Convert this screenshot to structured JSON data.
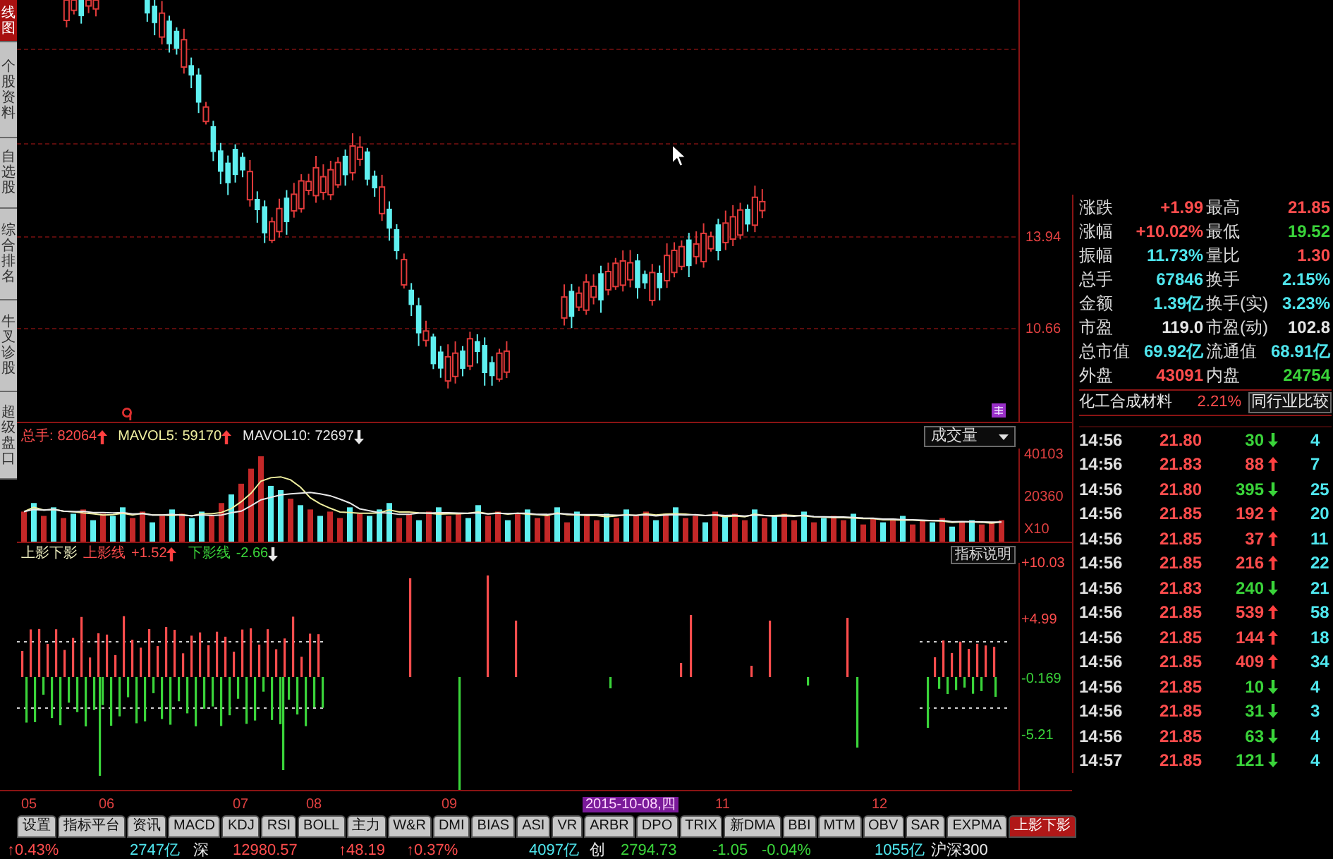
{
  "sidebar": {
    "tabs": [
      {
        "label": "线图",
        "selected": true
      },
      {
        "label": "个股资料",
        "selected": false
      },
      {
        "label": "自选股",
        "selected": false
      },
      {
        "label": "综合排名",
        "selected": false
      },
      {
        "label": "牛叉诊股",
        "selected": false
      },
      {
        "label": "超级盘口",
        "selected": false
      }
    ]
  },
  "price_panel": {
    "axis_labels": [
      "13.94",
      "10.66"
    ]
  },
  "volume_panel": {
    "legend": [
      {
        "label": "总手:",
        "value": "82064",
        "rising": true,
        "color": "#ff4d4d"
      },
      {
        "label": "MAVOL5:",
        "value": "59170",
        "rising": true,
        "color": "#f0f0a0"
      },
      {
        "label": "MAVOL10:",
        "value": "72697",
        "rising": false,
        "color": "#e8e8e8"
      }
    ],
    "indicator_select": {
      "value": "成交量"
    },
    "unit_label": "X10",
    "chart_data": {
      "type": "bar",
      "ylim": [
        0,
        43400
      ],
      "yticks": [
        20360,
        40103
      ],
      "stacked": true,
      "series": [
        {
          "color": "#c42828",
          "values": [
            14000,
            null,
            12000,
            null,
            11000,
            null,
            15000,
            null,
            13000,
            null,
            null,
            11000,
            14000,
            null,
            12000,
            null,
            13000,
            null,
            null,
            12000,
            18000,
            null,
            27000,
            34000,
            39800,
            null,
            null,
            20000,
            null,
            15000,
            null,
            14000,
            11000,
            null,
            13000,
            null,
            null,
            null,
            11000,
            13000,
            null,
            14000,
            null,
            12000,
            13000,
            null,
            null,
            12000,
            14000,
            null,
            13000,
            null,
            11000,
            12000,
            null,
            9000,
            null,
            12000,
            10000,
            null,
            11000,
            null,
            12000,
            14000,
            null,
            13000,
            null,
            11000,
            12000,
            null,
            14000,
            null,
            13000,
            10000,
            null,
            11000,
            null,
            13000,
            10000,
            null,
            9000,
            null,
            12000,
            10000,
            null,
            8000,
            11000,
            null,
            10000,
            null,
            8000,
            10000,
            null,
            11000,
            null,
            9000,
            null,
            8000,
            9000,
            10000
          ]
        },
        {
          "color": "#5ff0f0",
          "values": [
            null,
            18000,
            null,
            16000,
            null,
            13000,
            null,
            10000,
            null,
            12000,
            16000,
            null,
            null,
            9000,
            null,
            15000,
            null,
            11000,
            14000,
            null,
            null,
            22000,
            null,
            null,
            null,
            26000,
            24000,
            null,
            17000,
            null,
            12000,
            null,
            null,
            16000,
            null,
            12000,
            15000,
            18000,
            null,
            null,
            10000,
            null,
            16000,
            null,
            null,
            11000,
            17000,
            null,
            null,
            10000,
            null,
            15000,
            null,
            null,
            16000,
            null,
            14000,
            null,
            null,
            13000,
            null,
            15000,
            null,
            null,
            10000,
            null,
            16000,
            null,
            null,
            9000,
            null,
            12000,
            null,
            null,
            15000,
            null,
            12000,
            null,
            null,
            14000,
            null,
            11000,
            null,
            null,
            13000,
            null,
            null,
            9000,
            null,
            12000,
            null,
            null,
            9000,
            null,
            7000,
            null,
            10000,
            null,
            null,
            null
          ]
        },
        {
          "type": "line",
          "color": "#f0f0a0",
          "values": [
            14000,
            16000,
            14700,
            15000,
            14200,
            14000,
            13400,
            13000,
            12400,
            12600,
            13200,
            12400,
            13200,
            12400,
            12400,
            12200,
            12600,
            12000,
            13000,
            13000,
            13600,
            15400,
            18600,
            22600,
            28200,
            29800,
            30200,
            28800,
            25400,
            20400,
            17600,
            15600,
            13800,
            13600,
            13200,
            13200,
            13400,
            14800,
            13800,
            13800,
            13400,
            13200,
            12800,
            13000,
            13000,
            13200,
            13800,
            13000,
            13400,
            12800,
            13200,
            12800,
            12600,
            12200,
            13400,
            12600,
            12400,
            12200,
            12200,
            11600,
            12000,
            12600,
            12200,
            13000,
            12400,
            12800,
            13000,
            12800,
            12400,
            12200,
            12400,
            11600,
            12000,
            11600,
            12800,
            12200,
            12200,
            12400,
            12200,
            12000,
            11600,
            11400,
            11200,
            11200,
            11000,
            10800,
            10800,
            10200,
            10200,
            10000,
            10000,
            9800,
            9800,
            9600,
            9000,
            9200,
            9200,
            9000,
            8600,
            9200
          ]
        },
        {
          "type": "line",
          "color": "#e8e8e8",
          "values": [
            14000,
            15000,
            14700,
            15000,
            14200,
            14000,
            14100,
            13600,
            13600,
            13400,
            13600,
            12900,
            13100,
            12400,
            12400,
            12700,
            12300,
            12100,
            12500,
            12200,
            12400,
            13500,
            14200,
            16700,
            19500,
            20600,
            21800,
            22300,
            22600,
            22900,
            22300,
            21400,
            19800,
            18000,
            15300,
            14400,
            13500,
            13300,
            12700,
            12700,
            13300,
            13300,
            13500,
            13500,
            13300,
            13200,
            13400,
            12900,
            13200,
            13100,
            13200,
            13200,
            12700,
            12700,
            13100,
            12900,
            12600,
            12600,
            12600,
            12500,
            12300,
            12300,
            12300,
            12500,
            12000,
            12400,
            12600,
            12400,
            12600,
            12200,
            12500,
            12200,
            12300,
            11900,
            12400,
            12200,
            11800,
            12000,
            11800,
            12300,
            11700,
            11600,
            11500,
            11500,
            11300,
            11000,
            10900,
            10500,
            10500,
            10300,
            10200,
            10000,
            9800,
            9900,
            9300,
            9400,
            9300,
            9200,
            9100,
            9100
          ]
        }
      ]
    }
  },
  "indicator_panel": {
    "name": "上影下影",
    "legend": [
      {
        "label": "上影线",
        "value": "+1.52",
        "rising": true,
        "color": "#ff4d4d"
      },
      {
        "label": "下影线",
        "value": "-2.66",
        "rising": false,
        "color": "#3ad43a"
      }
    ],
    "help_button": "指标说明",
    "axis_labels": [
      {
        "text": "+10.03",
        "color": "#ff4d4d"
      },
      {
        "text": "+4.99",
        "color": "#ff4d4d"
      },
      {
        "text": "-0.169",
        "color": "#3ad43a"
      },
      {
        "text": "-5.21",
        "color": "#3ad43a"
      }
    ]
  },
  "date_axis": {
    "labels": [
      {
        "text": "05",
        "highlighted": false
      },
      {
        "text": "06",
        "highlighted": false
      },
      {
        "text": "07",
        "highlighted": false
      },
      {
        "text": "08",
        "highlighted": false
      },
      {
        "text": "09",
        "highlighted": false
      },
      {
        "text": "2015-10-08,四",
        "highlighted": true
      },
      {
        "text": "11",
        "highlighted": false
      },
      {
        "text": "12",
        "highlighted": false
      }
    ]
  },
  "quote": {
    "rows": [
      {
        "left": {
          "label": "涨跌",
          "value": "+1.99",
          "color": "#ff4d4d"
        },
        "right": {
          "label": "最高",
          "value": "21.85",
          "color": "#ff4d4d"
        }
      },
      {
        "left": {
          "label": "涨幅",
          "value": "+10.02%",
          "color": "#ff4d4d"
        },
        "right": {
          "label": "最低",
          "value": "19.52",
          "color": "#3ad43a"
        }
      },
      {
        "left": {
          "label": "振幅",
          "value": "11.73%",
          "color": "#4fe6ee"
        },
        "right": {
          "label": "量比",
          "value": "1.30",
          "color": "#ff4d4d"
        }
      },
      {
        "left": {
          "label": "总手",
          "value": "67846",
          "color": "#4fe6ee"
        },
        "right": {
          "label": "换手",
          "value": "2.15%",
          "color": "#4fe6ee"
        }
      },
      {
        "left": {
          "label": "金额",
          "value": "1.39亿",
          "color": "#4fe6ee"
        },
        "right": {
          "label": "换手(实)",
          "value": "3.23%",
          "color": "#4fe6ee"
        }
      },
      {
        "left": {
          "label": "市盈",
          "value": "119.0",
          "color": "#e6e6e6"
        },
        "right": {
          "label": "市盈(动)",
          "value": "102.8",
          "color": "#e6e6e6"
        }
      },
      {
        "left": {
          "label": "总市值",
          "value": "69.92亿",
          "color": "#4fe6ee"
        },
        "right": {
          "label": "流通值",
          "value": "68.91亿",
          "color": "#4fe6ee"
        }
      },
      {
        "left": {
          "label": "外盘",
          "value": "43091",
          "color": "#ff4d4d"
        },
        "right": {
          "label": "内盘",
          "value": "24754",
          "color": "#3ad43a"
        }
      }
    ]
  },
  "industry": {
    "name": "化工合成材料",
    "change": "2.21%",
    "button": "同行业比较"
  },
  "trades": [
    {
      "time": "14:56",
      "price": "21.80",
      "volume": "30",
      "rising": false,
      "column_5": "4"
    },
    {
      "time": "14:56",
      "price": "21.83",
      "volume": "88",
      "rising": true,
      "column_5": "7"
    },
    {
      "time": "14:56",
      "price": "21.80",
      "volume": "395",
      "rising": false,
      "column_5": "25"
    },
    {
      "time": "14:56",
      "price": "21.85",
      "volume": "192",
      "rising": true,
      "column_5": "20"
    },
    {
      "time": "14:56",
      "price": "21.85",
      "volume": "37",
      "rising": true,
      "column_5": "11"
    },
    {
      "time": "14:56",
      "price": "21.85",
      "volume": "216",
      "rising": true,
      "column_5": "22"
    },
    {
      "time": "14:56",
      "price": "21.83",
      "volume": "240",
      "rising": false,
      "column_5": "21"
    },
    {
      "time": "14:56",
      "price": "21.85",
      "volume": "539",
      "rising": true,
      "column_5": "58"
    },
    {
      "time": "14:56",
      "price": "21.85",
      "volume": "144",
      "rising": true,
      "column_5": "18"
    },
    {
      "time": "14:56",
      "price": "21.85",
      "volume": "409",
      "rising": true,
      "column_5": "34"
    },
    {
      "time": "14:56",
      "price": "21.85",
      "volume": "10",
      "rising": false,
      "column_5": "4"
    },
    {
      "time": "14:56",
      "price": "21.85",
      "volume": "31",
      "rising": false,
      "column_5": "3"
    },
    {
      "time": "14:56",
      "price": "21.85",
      "volume": "63",
      "rising": false,
      "column_5": "4"
    },
    {
      "time": "14:57",
      "price": "21.85",
      "volume": "121",
      "rising": false,
      "column_5": "4"
    }
  ],
  "tab_bar": [
    {
      "label": "设置",
      "selected": false
    },
    {
      "label": "指标平台",
      "selected": false
    },
    {
      "label": "资讯",
      "selected": false
    },
    {
      "label": "MACD",
      "selected": false
    },
    {
      "label": "KDJ",
      "selected": false
    },
    {
      "label": "RSI",
      "selected": false
    },
    {
      "label": "BOLL",
      "selected": false
    },
    {
      "label": "主力",
      "selected": false
    },
    {
      "label": "W&R",
      "selected": false
    },
    {
      "label": "DMI",
      "selected": false
    },
    {
      "label": "BIAS",
      "selected": false
    },
    {
      "label": "ASI",
      "selected": false
    },
    {
      "label": "VR",
      "selected": false
    },
    {
      "label": "ARBR",
      "selected": false
    },
    {
      "label": "DPO",
      "selected": false
    },
    {
      "label": "TRIX",
      "selected": false
    },
    {
      "label": "新DMA",
      "selected": false
    },
    {
      "label": "BBI",
      "selected": false
    },
    {
      "label": "MTM",
      "selected": false
    },
    {
      "label": "OBV",
      "selected": false
    },
    {
      "label": "SAR",
      "selected": false
    },
    {
      "label": "EXPMA",
      "selected": false
    },
    {
      "label": "上影下影",
      "selected": true
    }
  ],
  "status_bar": [
    {
      "text": "↑0.43%",
      "color": "#ff4d4d"
    },
    {
      "text": "2747亿",
      "color": "#4fe6ee"
    },
    {
      "text": "深",
      "color": "#e6e6e6"
    },
    {
      "text": "12980.57",
      "color": "#ff4d4d"
    },
    {
      "text": "↑48.19",
      "color": "#ff4d4d"
    },
    {
      "text": "↑0.37%",
      "color": "#ff4d4d"
    },
    {
      "text": "4097亿",
      "color": "#4fe6ee"
    },
    {
      "text": "创",
      "color": "#e6e6e6"
    },
    {
      "text": "2794.73",
      "color": "#3ad43a"
    },
    {
      "text": "-1.05",
      "color": "#3ad43a"
    },
    {
      "text": "-0.04%",
      "color": "#3ad43a"
    },
    {
      "text": "1055亿",
      "color": "#4fe6ee"
    },
    {
      "text": "沪深300",
      "color": "#e6e6e6"
    }
  ]
}
